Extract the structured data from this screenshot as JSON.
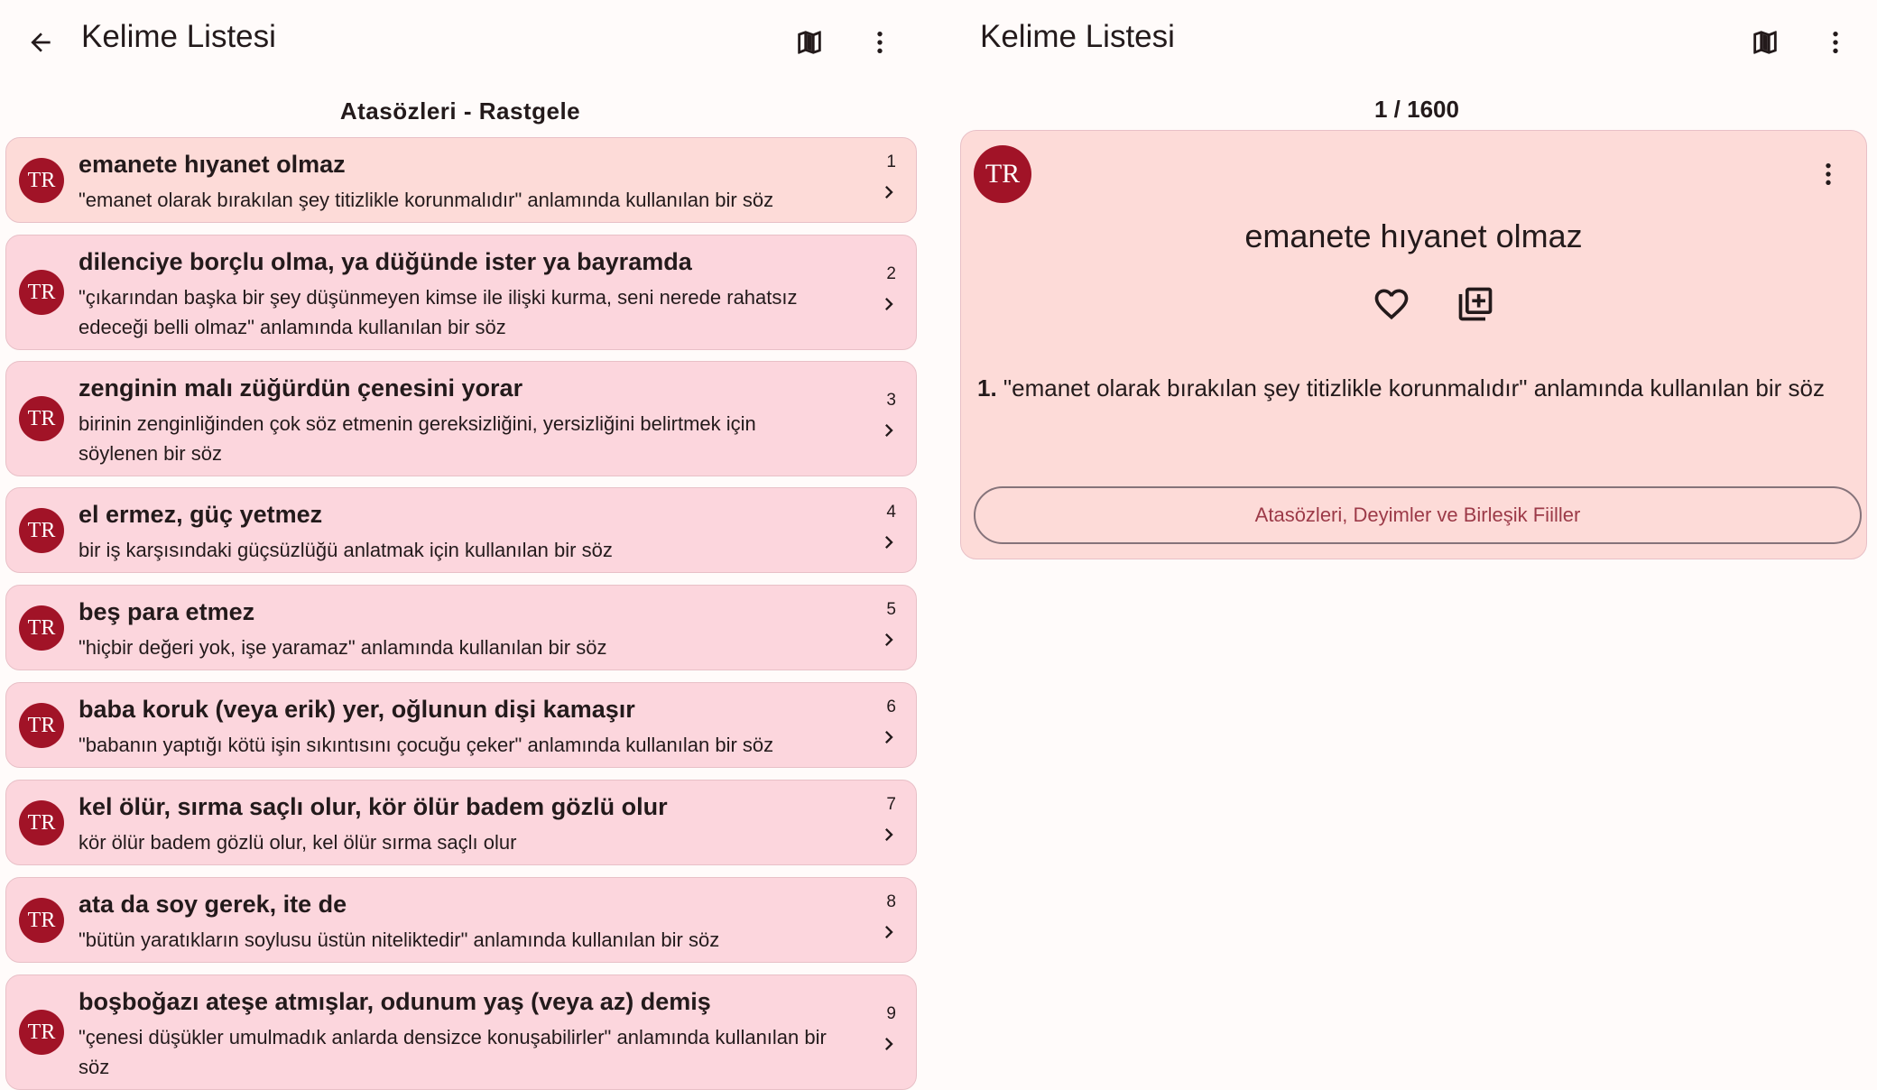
{
  "left": {
    "title": "Kelime Listesi",
    "subtitle": "Atasözleri - Rastgele",
    "items": [
      {
        "avatar": "TR",
        "head": "emanete hıyanet olmaz",
        "desc": "\"emanet olarak bırakılan şey titizlikle korunmalıdır\" anlamında kullanılan bir söz",
        "num": "1"
      },
      {
        "avatar": "TR",
        "head": "dilenciye borçlu olma, ya düğünde ister ya bayramda",
        "desc": "\"çıkarından başka bir şey düşünmeyen kimse ile ilişki kurma, seni nerede rahatsız edeceği belli olmaz\" anlamında kullanılan bir söz",
        "num": "2"
      },
      {
        "avatar": "TR",
        "head": "zenginin malı züğürdün çenesini yorar",
        "desc": "birinin zenginliğinden çok söz etmenin gereksizliğini, yersizliğini belirtmek için söylenen bir söz",
        "num": "3"
      },
      {
        "avatar": "TR",
        "head": "el ermez, güç yetmez",
        "desc": "bir iş karşısındaki güçsüzlüğü anlatmak için kullanılan bir söz",
        "num": "4"
      },
      {
        "avatar": "TR",
        "head": "beş para etmez",
        "desc": "\"hiçbir değeri yok, işe yaramaz\" anlamında kullanılan bir söz",
        "num": "5"
      },
      {
        "avatar": "TR",
        "head": "baba koruk (veya erik) yer, oğlunun dişi kamaşır",
        "desc": "\"babanın yaptığı kötü işin sıkıntısını çocuğu çeker\" anlamında kullanılan bir söz",
        "num": "6"
      },
      {
        "avatar": "TR",
        "head": "kel ölür, sırma saçlı olur, kör ölür badem gözlü olur",
        "desc": "kör ölür badem gözlü olur, kel ölür sırma saçlı olur",
        "num": "7"
      },
      {
        "avatar": "TR",
        "head": "ata da soy gerek, ite de",
        "desc": "\"bütün yaratıkların soylusu üstün niteliktedir\" anlamında kullanılan bir söz",
        "num": "8"
      },
      {
        "avatar": "TR",
        "head": "boşboğazı ateşe atmışlar, odunum yaş (veya az) demiş",
        "desc": "\"çenesi düşükler umulmadık anlarda densizce konuşabilirler\" anlamında kullanılan bir söz",
        "num": "9"
      }
    ]
  },
  "right": {
    "title": "Kelime Listesi",
    "counter": "1 / 1600",
    "card": {
      "avatar": "TR",
      "word": "emanete hıyanet olmaz",
      "def_num": "1.",
      "def_text": " \"emanet olarak bırakılan şey titizlikle korunmalıdır\" anlamında kullanılan bir söz",
      "category": "Atasözleri, Deyimler ve Birleşik Fiiller"
    }
  },
  "icons": {
    "back": "arrow-back-icon",
    "map": "map-icon",
    "more": "more-vert-icon",
    "chevron": "chevron-right-icon",
    "favorite": "heart-icon",
    "add": "library-add-icon"
  },
  "colors": {
    "background": "#fffbfa",
    "item_bg": "#fcd6dd",
    "selected_bg": "#fddbd8",
    "avatar_bg": "#a11327",
    "category_text": "#9c3a48"
  }
}
